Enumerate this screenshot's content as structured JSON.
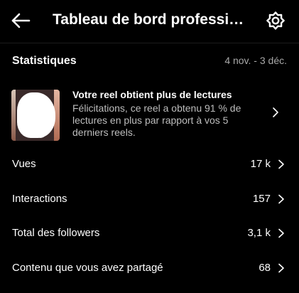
{
  "header": {
    "title": "Tableau de bord professionnel",
    "back_icon": "arrow-left-icon",
    "settings_icon": "gear-icon"
  },
  "stats": {
    "title": "Statistiques",
    "date_range": "4 nov. - 3 déc."
  },
  "highlight": {
    "title": "Votre reel obtient plus de lectures",
    "description": "Félicitations, ce reel a obtenu 91 % de lectures en plus par rapport à vos 5 derniers reels."
  },
  "rows": [
    {
      "label": "Vues",
      "value": "17 k"
    },
    {
      "label": "Interactions",
      "value": "157"
    },
    {
      "label": "Total des followers",
      "value": "3,1 k"
    },
    {
      "label": "Contenu que vous avez partagé",
      "value": "68"
    }
  ]
}
